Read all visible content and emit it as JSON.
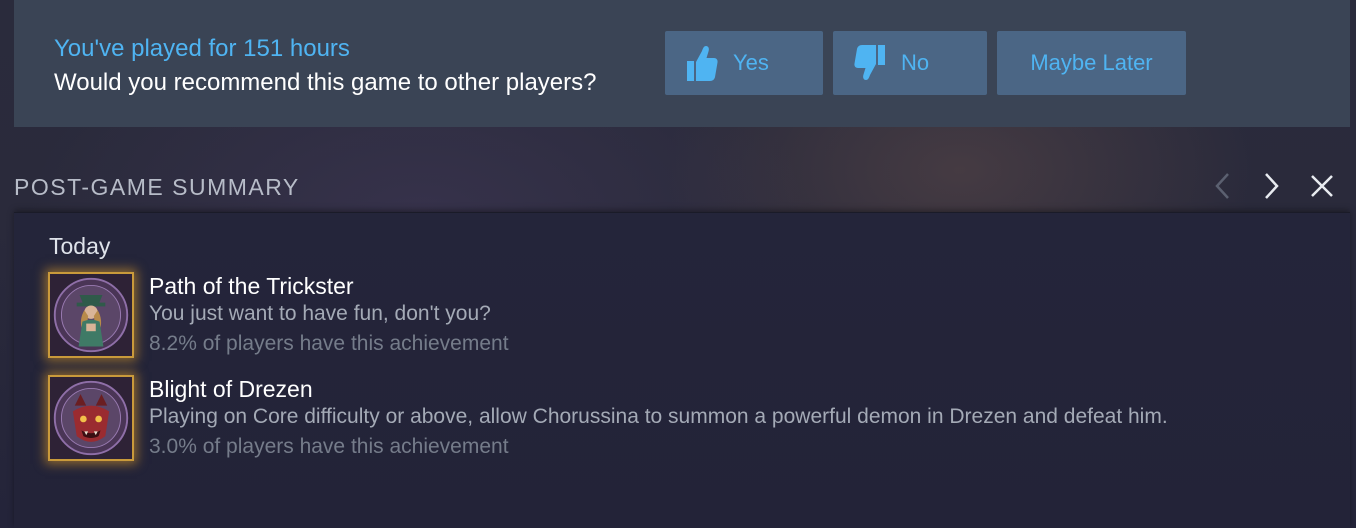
{
  "review_prompt": {
    "played_text": "You've played for 151 hours",
    "question": "Would you recommend this game to other players?",
    "buttons": {
      "yes": {
        "label": "Yes",
        "icon": "thumbs-up-icon"
      },
      "no": {
        "label": "No",
        "icon": "thumbs-down-icon"
      },
      "later": {
        "label": "Maybe Later"
      }
    }
  },
  "summary": {
    "title": "POST-GAME SUMMARY",
    "nav": {
      "prev_icon": "chevron-left-icon",
      "next_icon": "chevron-right-icon",
      "close_icon": "close-icon"
    },
    "day_label": "Today",
    "achievements": [
      {
        "name": "Path of the Trickster",
        "description": "You just want to have fun, don't you?",
        "rarity": "8.2% of players have this achievement",
        "icon": "trickster-achievement-icon"
      },
      {
        "name": "Blight of Drezen",
        "description": "Playing on Core difficulty or above, allow Chorussina to summon a powerful demon in Drezen and defeat him.",
        "rarity": "3.0% of players have this achievement",
        "icon": "demon-achievement-icon"
      }
    ]
  },
  "colors": {
    "accent_blue": "#4fb4f2",
    "button_bg": "#4b6685",
    "banner_bg": "#3a4455",
    "achievement_glow": "#c99a3b"
  }
}
